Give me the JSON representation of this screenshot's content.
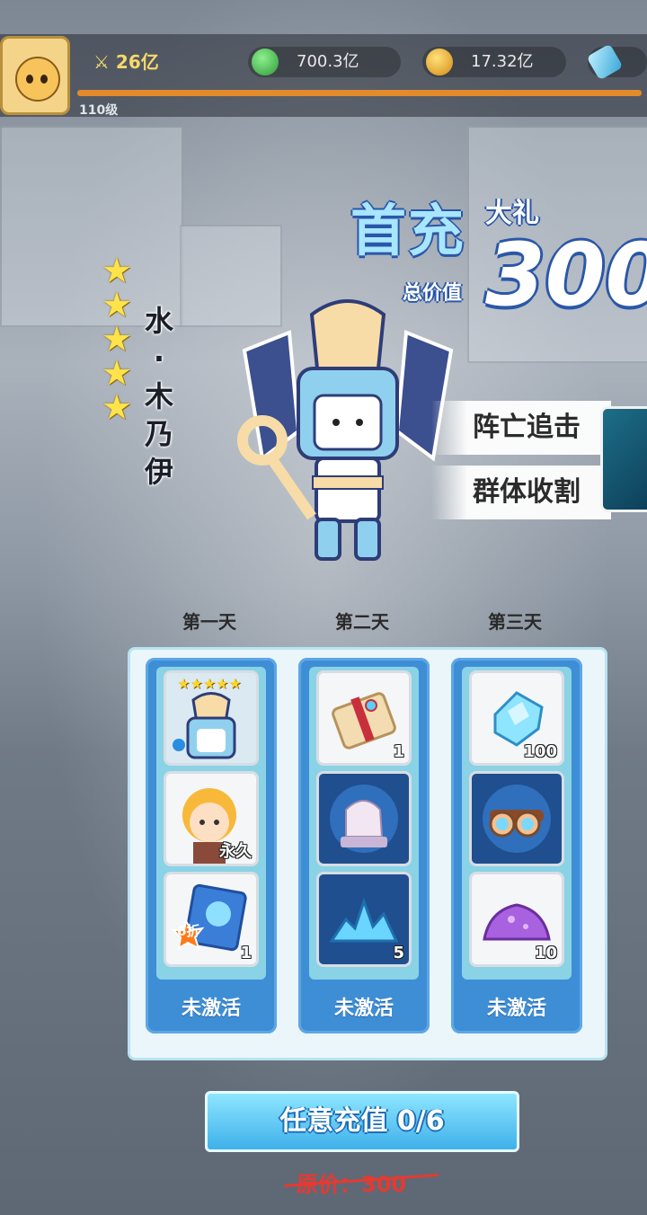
{
  "topbar": {
    "power": "26亿",
    "resources": [
      {
        "name": "green-orb",
        "value": "700.3亿",
        "color": "#3fb54a"
      },
      {
        "name": "gold-orb",
        "value": "17.32亿",
        "color": "#f0b030"
      },
      {
        "name": "blue-crystal",
        "value": "",
        "color": "#5cc4e8"
      }
    ],
    "level": "110级",
    "xp_fraction": 1.0
  },
  "title": {
    "main": "首充",
    "sub": "大礼",
    "total_label": "总价值",
    "total_value": "300"
  },
  "hero": {
    "stars": 5,
    "name_chars": [
      "水",
      "·",
      "木",
      "乃",
      "伊"
    ]
  },
  "skills": [
    "阵亡追击",
    "群体收割"
  ],
  "days": [
    {
      "label": "第一天",
      "status": "未激活",
      "items": [
        {
          "name": "mummy-hero-card",
          "count": "",
          "badge": "★★★★★"
        },
        {
          "name": "blonde-skin-card",
          "count": "永久"
        },
        {
          "name": "discount-crate",
          "count": "1",
          "badge": "6折"
        }
      ]
    },
    {
      "label": "第二天",
      "status": "未激活",
      "items": [
        {
          "name": "scroll",
          "count": "1"
        },
        {
          "name": "lion-statue",
          "count": ""
        },
        {
          "name": "blue-crystal-pile",
          "count": "5"
        }
      ]
    },
    {
      "label": "第三天",
      "status": "未激活",
      "items": [
        {
          "name": "diamond",
          "count": "100"
        },
        {
          "name": "goggles",
          "count": ""
        },
        {
          "name": "purple-dust",
          "count": "10"
        }
      ]
    }
  ],
  "button": {
    "label": "任意充值 0/6"
  },
  "original_price": "原价：300"
}
